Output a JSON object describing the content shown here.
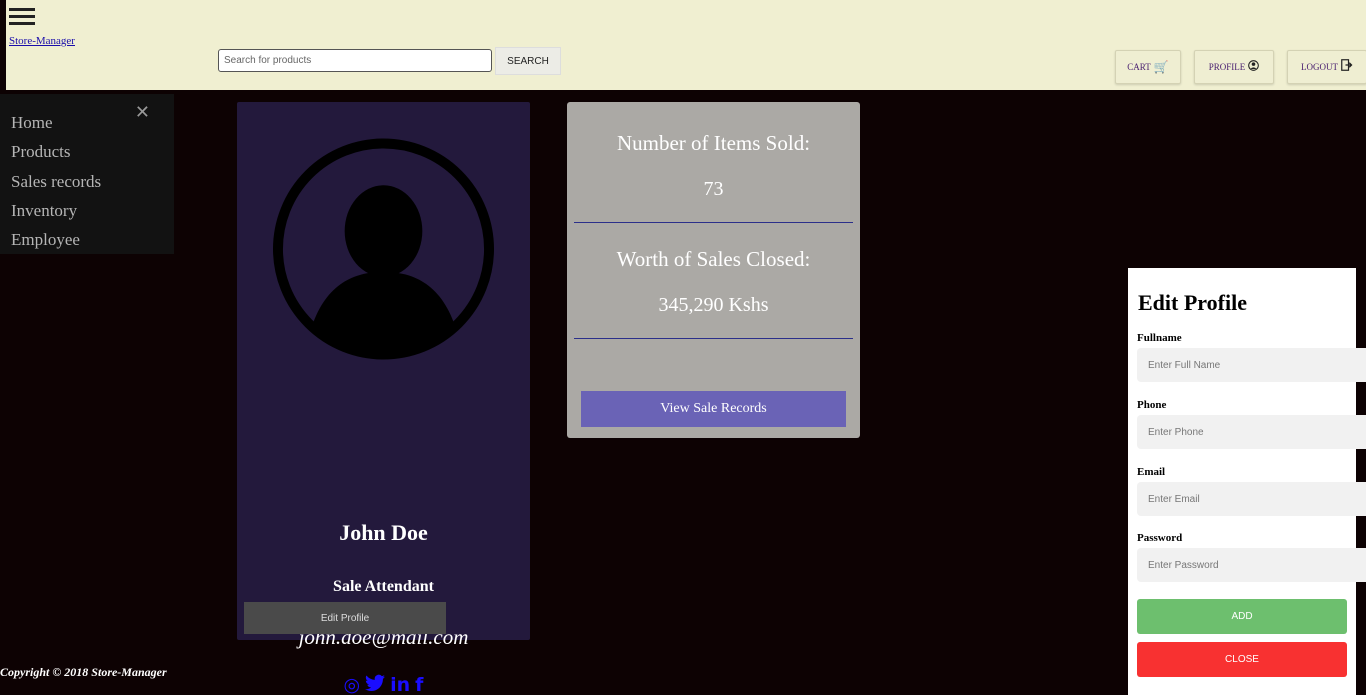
{
  "header": {
    "brand": "Store-Manager",
    "search_placeholder": "Search for products",
    "search_button": "SEARCH",
    "cart_label": "CART",
    "profile_label": "PROFILE",
    "logout_label": "LOGOUT"
  },
  "sidebar": {
    "items": [
      {
        "label": "Home"
      },
      {
        "label": "Products"
      },
      {
        "label": "Sales records"
      },
      {
        "label": "Inventory"
      },
      {
        "label": "Employee"
      }
    ]
  },
  "profile": {
    "name": "John Doe",
    "role": "Sale Attendant",
    "email": "john.doe@mail.com",
    "edit_button": "Edit Profile",
    "socials": [
      "dribbble-icon",
      "twitter-icon",
      "linkedin-icon",
      "facebook-icon"
    ]
  },
  "stats": {
    "items_sold_label": "Number of Items Sold:",
    "items_sold_value": "73",
    "sales_worth_label": "Worth of Sales Closed:",
    "sales_worth_value": "345,290 Kshs",
    "view_button": "View Sale Records"
  },
  "edit_form": {
    "title": "Edit Profile",
    "fullname_label": "Fullname",
    "fullname_placeholder": "Enter Full Name",
    "phone_label": "Phone",
    "phone_placeholder": "Enter Phone",
    "email_label": "Email",
    "email_placeholder": "Enter Email",
    "password_label": "Password",
    "password_placeholder": "Enter Password",
    "add_button": "ADD",
    "close_button": "CLOSE"
  },
  "footer": {
    "copyright": "Copyright © 2018 Store-Manager"
  },
  "colors": {
    "header_bg": "#f0efd1",
    "page_bg": "#0d0203",
    "profile_card_bg": "#23193c",
    "stats_card_bg": "#aba9a5",
    "view_button_bg": "#6a63b6",
    "add_button_bg": "#6dbf6e",
    "close_button_bg": "#f83131"
  }
}
